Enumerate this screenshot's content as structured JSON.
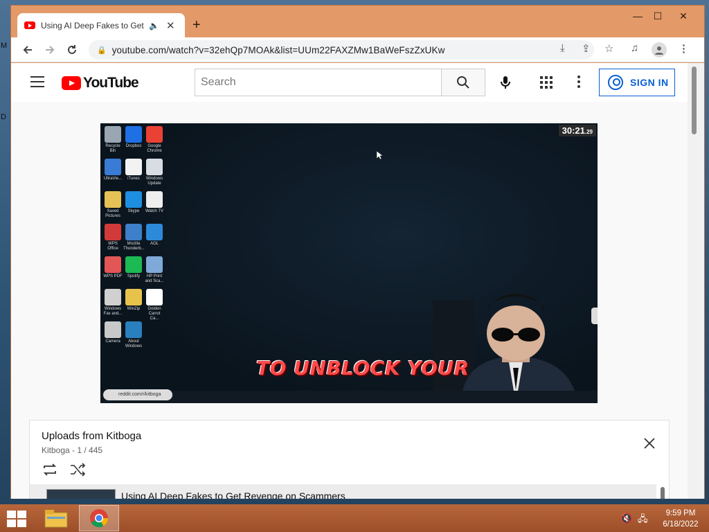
{
  "desktop": {
    "edge_letters": [
      "M",
      "D"
    ]
  },
  "window": {
    "controls": {
      "minimize": "—",
      "maximize": "☐",
      "close": "✕"
    },
    "tab": {
      "title": "Using AI Deep Fakes to Get Re",
      "audio_icon": "speaker-icon",
      "close": "✕"
    },
    "new_tab": "+"
  },
  "toolbar": {
    "url": "youtube.com/watch?v=32ehQp7MOAk&list=UUm22FAXZMw1BaWeFszZxUKw",
    "icons": [
      "back-icon",
      "forward-icon",
      "reload-icon",
      "lock-icon",
      "install-icon",
      "share-icon",
      "star-icon",
      "media-icon",
      "profile-icon",
      "menu-icon"
    ]
  },
  "youtube": {
    "wordmark": "YouTube",
    "search": {
      "placeholder": "Search",
      "value": ""
    },
    "sign_in": "SIGN IN"
  },
  "video": {
    "timer": "30:21",
    "timer_frac": ".29",
    "caption": "TO UNBLOCK YOUR",
    "reddit_tag": "reddit.com/r/kitboga",
    "desktop_icons": [
      {
        "label": "Recycle Bin",
        "color": "#9aa6b2"
      },
      {
        "label": "Dropbox",
        "color": "#1f6fe5"
      },
      {
        "label": "Google Chrome",
        "color": "#e94235"
      },
      {
        "label": "UltraVie...",
        "color": "#3a7bd5"
      },
      {
        "label": "iTunes",
        "color": "#f2f2f2"
      },
      {
        "label": "Windows Update",
        "color": "#d7dde3"
      },
      {
        "label": "Saved Pictures",
        "color": "#e6c256"
      },
      {
        "label": "Skype",
        "color": "#1d8ee0"
      },
      {
        "label": "Watch TV",
        "color": "#eeeeee"
      },
      {
        "label": "WPS Office",
        "color": "#d23a3a"
      },
      {
        "label": "Mozilla Thunderb...",
        "color": "#3d7fc8"
      },
      {
        "label": "AOL",
        "color": "#2c8ad8"
      },
      {
        "label": "WPS PDF",
        "color": "#e25656"
      },
      {
        "label": "Spotify",
        "color": "#1db954"
      },
      {
        "label": "HP Print and Sca...",
        "color": "#7fa9d9"
      },
      {
        "label": "Windows Fax and...",
        "color": "#d0d0d0"
      },
      {
        "label": "WinZip",
        "color": "#e7c34c"
      },
      {
        "label": "Golden Carrot Ca...",
        "color": "#ffffff"
      },
      {
        "label": "Camera",
        "color": "#c9c9c9"
      },
      {
        "label": "About Windows",
        "color": "#2a7fbf"
      }
    ]
  },
  "playlist": {
    "title": "Uploads from Kitboga",
    "channel": "Kitboga",
    "position": "1 / 445",
    "separator": " - ",
    "current_item": "Using AI Deep Fakes to Get Revenge on Scammers"
  },
  "taskbar": {
    "time": "9:59 PM",
    "date": "6/18/2022",
    "apps": [
      "file-explorer-icon",
      "chrome-icon"
    ]
  }
}
